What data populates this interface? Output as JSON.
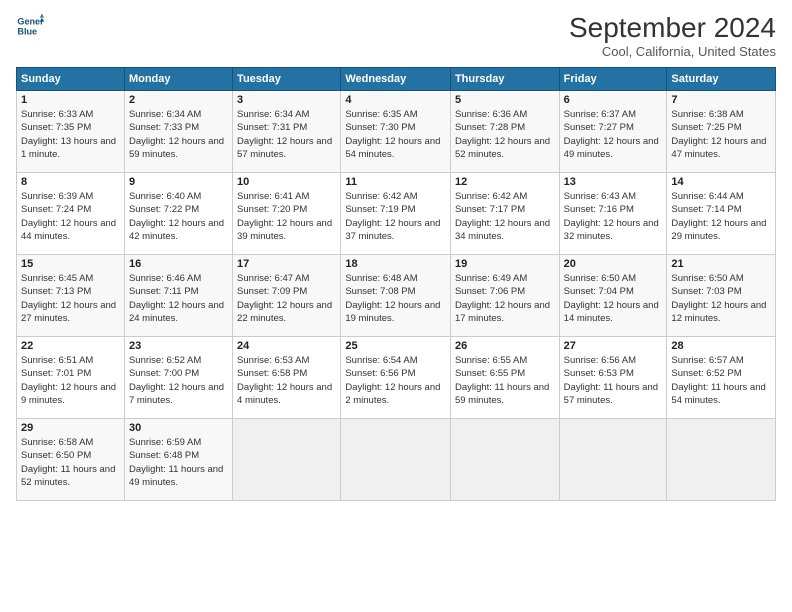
{
  "header": {
    "logo_line1": "General",
    "logo_line2": "Blue",
    "month_title": "September 2024",
    "location": "Cool, California, United States"
  },
  "weekdays": [
    "Sunday",
    "Monday",
    "Tuesday",
    "Wednesday",
    "Thursday",
    "Friday",
    "Saturday"
  ],
  "weeks": [
    [
      {
        "day": "1",
        "sunrise": "6:33 AM",
        "sunset": "7:35 PM",
        "daylight": "13 hours and 1 minute."
      },
      {
        "day": "2",
        "sunrise": "6:34 AM",
        "sunset": "7:33 PM",
        "daylight": "12 hours and 59 minutes."
      },
      {
        "day": "3",
        "sunrise": "6:34 AM",
        "sunset": "7:31 PM",
        "daylight": "12 hours and 57 minutes."
      },
      {
        "day": "4",
        "sunrise": "6:35 AM",
        "sunset": "7:30 PM",
        "daylight": "12 hours and 54 minutes."
      },
      {
        "day": "5",
        "sunrise": "6:36 AM",
        "sunset": "7:28 PM",
        "daylight": "12 hours and 52 minutes."
      },
      {
        "day": "6",
        "sunrise": "6:37 AM",
        "sunset": "7:27 PM",
        "daylight": "12 hours and 49 minutes."
      },
      {
        "day": "7",
        "sunrise": "6:38 AM",
        "sunset": "7:25 PM",
        "daylight": "12 hours and 47 minutes."
      }
    ],
    [
      {
        "day": "8",
        "sunrise": "6:39 AM",
        "sunset": "7:24 PM",
        "daylight": "12 hours and 44 minutes."
      },
      {
        "day": "9",
        "sunrise": "6:40 AM",
        "sunset": "7:22 PM",
        "daylight": "12 hours and 42 minutes."
      },
      {
        "day": "10",
        "sunrise": "6:41 AM",
        "sunset": "7:20 PM",
        "daylight": "12 hours and 39 minutes."
      },
      {
        "day": "11",
        "sunrise": "6:42 AM",
        "sunset": "7:19 PM",
        "daylight": "12 hours and 37 minutes."
      },
      {
        "day": "12",
        "sunrise": "6:42 AM",
        "sunset": "7:17 PM",
        "daylight": "12 hours and 34 minutes."
      },
      {
        "day": "13",
        "sunrise": "6:43 AM",
        "sunset": "7:16 PM",
        "daylight": "12 hours and 32 minutes."
      },
      {
        "day": "14",
        "sunrise": "6:44 AM",
        "sunset": "7:14 PM",
        "daylight": "12 hours and 29 minutes."
      }
    ],
    [
      {
        "day": "15",
        "sunrise": "6:45 AM",
        "sunset": "7:13 PM",
        "daylight": "12 hours and 27 minutes."
      },
      {
        "day": "16",
        "sunrise": "6:46 AM",
        "sunset": "7:11 PM",
        "daylight": "12 hours and 24 minutes."
      },
      {
        "day": "17",
        "sunrise": "6:47 AM",
        "sunset": "7:09 PM",
        "daylight": "12 hours and 22 minutes."
      },
      {
        "day": "18",
        "sunrise": "6:48 AM",
        "sunset": "7:08 PM",
        "daylight": "12 hours and 19 minutes."
      },
      {
        "day": "19",
        "sunrise": "6:49 AM",
        "sunset": "7:06 PM",
        "daylight": "12 hours and 17 minutes."
      },
      {
        "day": "20",
        "sunrise": "6:50 AM",
        "sunset": "7:04 PM",
        "daylight": "12 hours and 14 minutes."
      },
      {
        "day": "21",
        "sunrise": "6:50 AM",
        "sunset": "7:03 PM",
        "daylight": "12 hours and 12 minutes."
      }
    ],
    [
      {
        "day": "22",
        "sunrise": "6:51 AM",
        "sunset": "7:01 PM",
        "daylight": "12 hours and 9 minutes."
      },
      {
        "day": "23",
        "sunrise": "6:52 AM",
        "sunset": "7:00 PM",
        "daylight": "12 hours and 7 minutes."
      },
      {
        "day": "24",
        "sunrise": "6:53 AM",
        "sunset": "6:58 PM",
        "daylight": "12 hours and 4 minutes."
      },
      {
        "day": "25",
        "sunrise": "6:54 AM",
        "sunset": "6:56 PM",
        "daylight": "12 hours and 2 minutes."
      },
      {
        "day": "26",
        "sunrise": "6:55 AM",
        "sunset": "6:55 PM",
        "daylight": "11 hours and 59 minutes."
      },
      {
        "day": "27",
        "sunrise": "6:56 AM",
        "sunset": "6:53 PM",
        "daylight": "11 hours and 57 minutes."
      },
      {
        "day": "28",
        "sunrise": "6:57 AM",
        "sunset": "6:52 PM",
        "daylight": "11 hours and 54 minutes."
      }
    ],
    [
      {
        "day": "29",
        "sunrise": "6:58 AM",
        "sunset": "6:50 PM",
        "daylight": "11 hours and 52 minutes."
      },
      {
        "day": "30",
        "sunrise": "6:59 AM",
        "sunset": "6:48 PM",
        "daylight": "11 hours and 49 minutes."
      },
      null,
      null,
      null,
      null,
      null
    ]
  ]
}
